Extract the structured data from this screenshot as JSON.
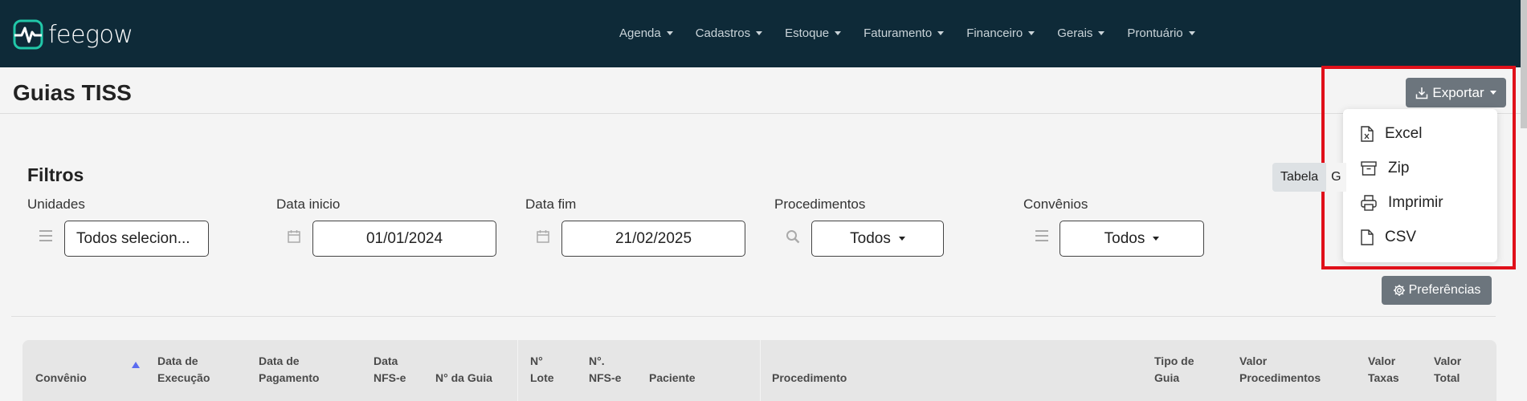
{
  "app": {
    "logo_text": "feegow",
    "brand_color": "#0e2a38",
    "accent_color": "#21c7a8"
  },
  "nav": {
    "items": [
      {
        "label": "Agenda"
      },
      {
        "label": "Cadastros"
      },
      {
        "label": "Estoque"
      },
      {
        "label": "Faturamento"
      },
      {
        "label": "Financeiro"
      },
      {
        "label": "Gerais"
      },
      {
        "label": "Prontuário"
      }
    ]
  },
  "page": {
    "title": "Guias TISS"
  },
  "export": {
    "label": "Exportar",
    "menu": [
      {
        "label": "Excel",
        "icon": "excel-file-icon"
      },
      {
        "label": "Zip",
        "icon": "archive-icon"
      },
      {
        "label": "Imprimir",
        "icon": "printer-icon"
      },
      {
        "label": "CSV",
        "icon": "file-icon"
      }
    ]
  },
  "filters": {
    "title": "Filtros",
    "unidades": {
      "label": "Unidades",
      "value": "Todos selecion..."
    },
    "data_inicio": {
      "label": "Data inicio",
      "value": "01/01/2024"
    },
    "data_fim": {
      "label": "Data fim",
      "value": "21/02/2025"
    },
    "procedimentos": {
      "label": "Procedimentos",
      "value": "Todos"
    },
    "convenios": {
      "label": "Convênios",
      "value": "Todos"
    }
  },
  "view": {
    "tabela": "Tabela",
    "other": "G"
  },
  "preferences": {
    "label": "Preferências"
  },
  "table": {
    "columns": [
      {
        "l1": "",
        "l2": "Convênio"
      },
      {
        "l1": "Data de",
        "l2": "Execução"
      },
      {
        "l1": "Data de",
        "l2": "Pagamento"
      },
      {
        "l1": "Data",
        "l2": "NFS-e"
      },
      {
        "l1": "",
        "l2": "N° da Guia"
      },
      {
        "l1": "N°",
        "l2": "Lote"
      },
      {
        "l1": "N°.",
        "l2": "NFS-e"
      },
      {
        "l1": "",
        "l2": "Paciente"
      },
      {
        "l1": "",
        "l2": "Procedimento"
      },
      {
        "l1": "Tipo de",
        "l2": "Guia"
      },
      {
        "l1": "Valor",
        "l2": "Procedimentos"
      },
      {
        "l1": "Valor",
        "l2": "Taxas"
      },
      {
        "l1": "Valor",
        "l2": "Total"
      }
    ]
  }
}
